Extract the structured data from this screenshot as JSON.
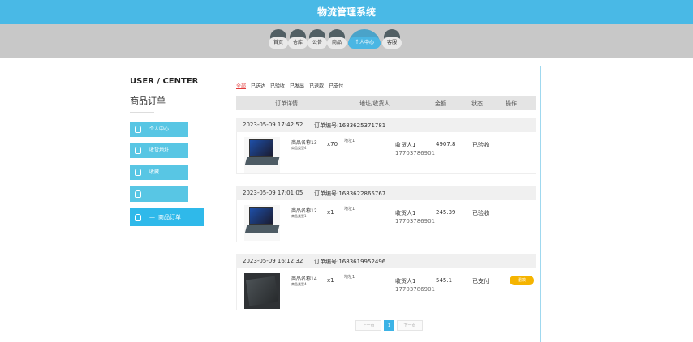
{
  "app": {
    "title": "物流管理系统"
  },
  "nav": [
    "首页",
    "仓库",
    "公告",
    "商品",
    "个人中心",
    "客服"
  ],
  "sidebar": {
    "heading": "USER / CENTER",
    "subheading": "商品订单",
    "items": [
      "个人中心",
      "收货地址",
      "收藏",
      "商品订单"
    ],
    "active_prefix": "—"
  },
  "filters": [
    "全部",
    "已送达",
    "已验收",
    "已发出",
    "已退款",
    "已支付"
  ],
  "table_headers": [
    "订单详情",
    "地址/收货人",
    "金额",
    "状态",
    "操作"
  ],
  "orders": [
    {
      "date": "2023-05-09 17:42:52",
      "number": "订单编号:1683625371781",
      "product": "商品名称13",
      "spec": "商品类型4",
      "qty": "x70",
      "address": "地址1",
      "receiver": "收货人1",
      "phone": "17703786901",
      "amount": "4907.8",
      "status": "已验收"
    },
    {
      "date": "2023-05-09 17:01:05",
      "number": "订单编号:1683622865767",
      "product": "商品名称12",
      "spec": "商品类型1",
      "qty": "x1",
      "address": "地址1",
      "receiver": "收货人1",
      "phone": "17703786901",
      "amount": "245.39",
      "status": "已验收"
    },
    {
      "date": "2023-05-09 16:12:32",
      "number": "订单编号:1683619952496",
      "product": "商品名称14",
      "spec": "商品类型4",
      "qty": "x1",
      "address": "地址1",
      "receiver": "收货人1",
      "phone": "17703786901",
      "amount": "545.1",
      "status": "已支付",
      "action": "退款"
    }
  ],
  "pagination": {
    "prev": "上一页",
    "current": "1",
    "next": "下一页"
  },
  "colors": {
    "header": "#49b9e6",
    "sidebar_item": "#58c6e4",
    "active_filter": "#e23b3b",
    "action_button": "#f5b400"
  }
}
